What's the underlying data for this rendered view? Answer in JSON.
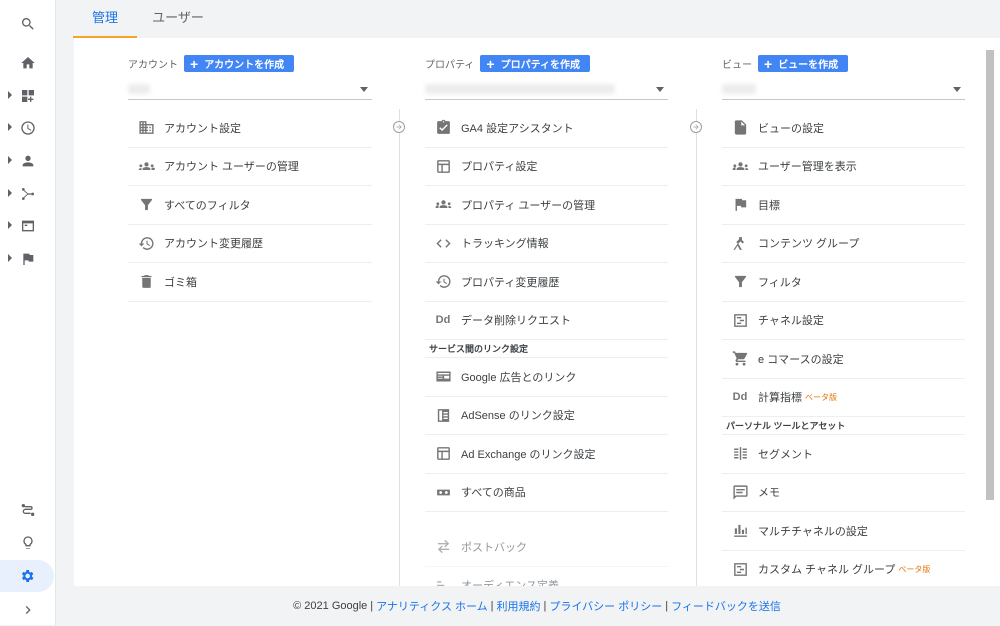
{
  "tabs": [
    {
      "label": "管理"
    },
    {
      "label": "ユーザー"
    }
  ],
  "account": {
    "label": "アカウント",
    "create_label": "アカウントを作成",
    "items": [
      {
        "icon": "building-icon",
        "label": "アカウント設定"
      },
      {
        "icon": "people-icon",
        "label": "アカウント ユーザーの管理"
      },
      {
        "icon": "filter-icon",
        "label": "すべてのフィルタ"
      },
      {
        "icon": "history-icon",
        "label": "アカウント変更履歴"
      },
      {
        "icon": "trash-icon",
        "label": "ゴミ箱"
      }
    ]
  },
  "property": {
    "label": "プロパティ",
    "create_label": "プロパティを作成",
    "items": [
      {
        "icon": "checklist-icon",
        "label": "GA4 設定アシスタント"
      },
      {
        "icon": "layout-icon",
        "label": "プロパティ設定"
      },
      {
        "icon": "people-icon",
        "label": "プロパティ ユーザーの管理"
      },
      {
        "icon": "code-icon",
        "label": "トラッキング情報"
      },
      {
        "icon": "history-icon",
        "label": "プロパティ変更履歴"
      },
      {
        "icon": "dd-icon",
        "icon_text": "Dd",
        "label": "データ削除リクエスト"
      }
    ],
    "section_label": "サービス間のリンク設定",
    "links": [
      {
        "icon": "google-ads-icon",
        "label": "Google 広告とのリンク"
      },
      {
        "icon": "adsense-icon",
        "label": "AdSense のリンク設定"
      },
      {
        "icon": "adexchange-icon",
        "label": "Ad Exchange のリンク設定"
      },
      {
        "icon": "link-icon",
        "label": "すべての商品"
      },
      {
        "icon": "postback-icon",
        "label": "ポストバック"
      },
      {
        "icon": "audience-icon",
        "label": "オーディエンス定義"
      }
    ]
  },
  "view": {
    "label": "ビュー",
    "create_label": "ビューを作成",
    "items": [
      {
        "icon": "document-icon",
        "label": "ビューの設定",
        "beta": ""
      },
      {
        "icon": "people-icon",
        "label": "ユーザー管理を表示",
        "beta": ""
      },
      {
        "icon": "flag-icon",
        "label": "目標",
        "beta": ""
      },
      {
        "icon": "content-group-icon",
        "label": "コンテンツ グループ",
        "beta": ""
      },
      {
        "icon": "filter-icon",
        "label": "フィルタ",
        "beta": ""
      },
      {
        "icon": "channel-icon",
        "label": "チャネル設定",
        "beta": ""
      },
      {
        "icon": "cart-icon",
        "label": "e コマースの設定",
        "beta": ""
      },
      {
        "icon": "dd-icon",
        "icon_text": "Dd",
        "label": "計算指標",
        "beta": "ベータ版"
      }
    ],
    "section_label": "パーソナル ツールとアセット",
    "tools": [
      {
        "icon": "segment-icon",
        "label": "セグメント",
        "beta": ""
      },
      {
        "icon": "comment-icon",
        "label": "メモ",
        "beta": ""
      },
      {
        "icon": "bar-chart-icon",
        "label": "マルチチャネルの設定",
        "beta": ""
      },
      {
        "icon": "channel-icon",
        "label": "カスタム チャネル グループ",
        "beta": "ベータ版"
      }
    ]
  },
  "footer": {
    "copyright": "© 2021 Google",
    "links": [
      "アナリティクス ホーム",
      "利用規約",
      "プライバシー ポリシー",
      "フィードバックを送信"
    ]
  }
}
